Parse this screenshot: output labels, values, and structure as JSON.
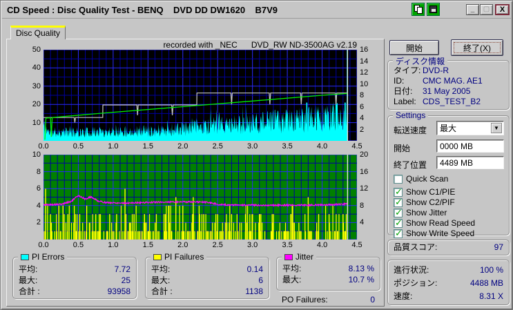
{
  "window": {
    "title": "CD Speed : Disc Quality Test - BENQ    DVD DD DW1620    B7V9",
    "minimize_label": "_",
    "close_label": "X"
  },
  "tab": {
    "label": "Disc Quality"
  },
  "recorded_note": "recorded with _NEC      DVD_RW ND-3500AG v2.19",
  "buttons": {
    "start": "開始",
    "stop": "終了(X)"
  },
  "disc_info": {
    "title": "ディスク情報",
    "rows": [
      {
        "label": "タイプ:",
        "value": "DVD-R"
      },
      {
        "label": "ID:",
        "value": "CMC MAG. AE1"
      },
      {
        "label": "日付:",
        "value": "31 May 2005"
      },
      {
        "label": "Label:",
        "value": "CDS_TEST_B2"
      }
    ]
  },
  "settings": {
    "title": "Settings",
    "speed_label": "転送速度",
    "speed_value": "最大",
    "start_label": "開始",
    "start_value": "0000 MB",
    "end_label": "終了位置",
    "end_value": "4489 MB",
    "checkboxes": [
      {
        "label": "Quick Scan",
        "checked": false
      },
      {
        "label": "Show C1/PIE",
        "checked": true
      },
      {
        "label": "Show C2/PIF",
        "checked": true
      },
      {
        "label": "Show Jitter",
        "checked": true
      },
      {
        "label": "Show Read Speed",
        "checked": true
      },
      {
        "label": "Show Write Speed",
        "checked": true
      }
    ]
  },
  "score": {
    "label": "品質スコア:",
    "value": "97"
  },
  "progress": {
    "rows": [
      {
        "label": "進行状況:",
        "value": "100 %"
      },
      {
        "label": "ポジション:",
        "value": "4488 MB"
      },
      {
        "label": "速度:",
        "value": "8.31 X"
      }
    ]
  },
  "stats": {
    "pi_errors": {
      "title": "PI Errors",
      "swatch": "#00FFFF",
      "rows": [
        {
          "label": "平均:",
          "value": "7.72"
        },
        {
          "label": "最大:",
          "value": "25"
        },
        {
          "label": "合計 :",
          "value": "93958"
        }
      ]
    },
    "pi_failures": {
      "title": "PI Failures",
      "swatch": "#FFFF00",
      "rows": [
        {
          "label": "平均:",
          "value": "0.14"
        },
        {
          "label": "最大:",
          "value": "6"
        },
        {
          "label": "合計 :",
          "value": "1138"
        }
      ]
    },
    "jitter": {
      "title": "Jitter",
      "swatch": "#FF00FF",
      "rows": [
        {
          "label": "平均:",
          "value": "8.13 %"
        },
        {
          "label": "最大:",
          "value": "10.7 %"
        }
      ]
    },
    "po_failures": {
      "label": "PO Failures:",
      "value": "0"
    }
  },
  "chart_data": [
    {
      "type": "area",
      "title": "PI Errors (cyan area, left axis) with read/write speed lines (right axis)",
      "x_range": [
        0,
        4.5
      ],
      "x_end": 4.365,
      "x_ticks": [
        "0.0",
        "0.5",
        "1.0",
        "1.5",
        "2.0",
        "2.5",
        "3.0",
        "3.5",
        "4.0",
        "4.5"
      ],
      "bg": "#000000",
      "grid": {
        "x_minor": 0.1,
        "x_major": 0.5,
        "y_minor": 5,
        "y_major": 10,
        "minor_color": "#0000A0",
        "major_color": "#2A2AFF"
      },
      "y_left": {
        "max": 50,
        "ticks": [
          50,
          40,
          30,
          20,
          10
        ]
      },
      "y_right": {
        "max": 16,
        "ticks": [
          16,
          14,
          12,
          10,
          8,
          6,
          4,
          2
        ]
      },
      "series": [
        {
          "name": "pi-errors",
          "style": "area_noise",
          "axis": "left",
          "color": "#00FFFF",
          "seed": 11,
          "samples": 760,
          "noise_lo": 0.35,
          "noise_hi": 1.5,
          "cap": 24,
          "anchors": [
            [
              0,
              9
            ],
            [
              0.08,
              5
            ],
            [
              0.5,
              5
            ],
            [
              1.0,
              5.5
            ],
            [
              1.5,
              6
            ],
            [
              2.0,
              7
            ],
            [
              2.18,
              8.5
            ],
            [
              2.6,
              9
            ],
            [
              3.0,
              10.5
            ],
            [
              3.5,
              12
            ],
            [
              4.0,
              13.5
            ],
            [
              4.25,
              15
            ],
            [
              4.365,
              15
            ]
          ],
          "spikes": [
            [
              3.78,
              21
            ],
            [
              4.2,
              25
            ],
            [
              4.33,
              21
            ],
            [
              4.362,
              50
            ]
          ]
        },
        {
          "name": "write-speed",
          "style": "line",
          "axis": "right",
          "color": "#C8C8C8",
          "width": 1.2,
          "points": [
            [
              0,
              4.1
            ],
            [
              0.44,
              4.1
            ],
            [
              0.45,
              3.2
            ],
            [
              0.46,
              4.1
            ],
            [
              0.85,
              4.1
            ],
            [
              0.852,
              6.3
            ],
            [
              1.34,
              6.3
            ],
            [
              1.35,
              4.5
            ],
            [
              1.36,
              6.3
            ],
            [
              1.84,
              6.3
            ],
            [
              1.85,
              4.5
            ],
            [
              1.86,
              6.3
            ],
            [
              2.2,
              6.3
            ],
            [
              2.202,
              8.4
            ],
            [
              2.69,
              8.4
            ],
            [
              2.7,
              6.4
            ],
            [
              2.71,
              8.4
            ],
            [
              3.24,
              8.4
            ],
            [
              3.25,
              6.4
            ],
            [
              3.26,
              8.4
            ],
            [
              3.69,
              8.4
            ],
            [
              3.7,
              6.4
            ],
            [
              3.71,
              8.4
            ],
            [
              4.19,
              8.4
            ],
            [
              4.2,
              6.4
            ],
            [
              4.21,
              8.4
            ],
            [
              4.365,
              8.4
            ]
          ]
        },
        {
          "name": "read-speed",
          "style": "line",
          "axis": "right",
          "color": "#00EE00",
          "width": 1.3,
          "points": [
            [
              0.02,
              0.2
            ],
            [
              0.035,
              4.0
            ],
            [
              0.1,
              4.05
            ],
            [
              0.112,
              0.7
            ],
            [
              0.125,
              4.1
            ],
            [
              1.0,
              5.02
            ],
            [
              2.0,
              6.0
            ],
            [
              3.0,
              7.0
            ],
            [
              4.0,
              8.0
            ],
            [
              4.365,
              8.31
            ]
          ]
        },
        {
          "name": "end-marker",
          "style": "vline",
          "x": 4.365,
          "color": "#E0E0E0"
        }
      ]
    },
    {
      "type": "bar",
      "title": "PI Failures (yellow bars, left axis) with jitter % line (right axis)",
      "x_range": [
        0,
        4.5
      ],
      "x_end": 4.365,
      "x_ticks": [
        "0.0",
        "0.5",
        "1.0",
        "1.5",
        "2.0",
        "2.5",
        "3.0",
        "3.5",
        "4.0",
        "4.5"
      ],
      "bg": "#008000",
      "grid": {
        "x_minor": 0.1,
        "x_major": 0.5,
        "y_minor": 1,
        "y_major": 2,
        "minor_color": "#0000A0",
        "major_color": "#2A2AFF"
      },
      "y_left": {
        "max": 10,
        "ticks": [
          10,
          8,
          6,
          4,
          2
        ]
      },
      "y_right": {
        "max": 20,
        "ticks": [
          20,
          16,
          12,
          8,
          4
        ]
      },
      "series": [
        {
          "name": "pi-failures",
          "style": "bars",
          "axis": "left",
          "color": "#FFFF00",
          "seed": 23,
          "step": 0.008,
          "density": 0.4,
          "tall_bars": [
            [
              0.03,
              6
            ],
            [
              0.1,
              3
            ],
            [
              0.22,
              4
            ],
            [
              0.28,
              4
            ],
            [
              0.35,
              3
            ],
            [
              0.52,
              3
            ],
            [
              0.62,
              4
            ],
            [
              0.75,
              3
            ],
            [
              0.8,
              3
            ],
            [
              0.95,
              3
            ],
            [
              1.05,
              3
            ],
            [
              1.17,
              6
            ],
            [
              1.3,
              3
            ],
            [
              1.45,
              3
            ],
            [
              1.62,
              3
            ],
            [
              1.75,
              3
            ],
            [
              1.9,
              5
            ],
            [
              2.0,
              4
            ],
            [
              2.15,
              5
            ],
            [
              2.3,
              3
            ],
            [
              2.5,
              3
            ],
            [
              2.7,
              3
            ],
            [
              2.9,
              3
            ],
            [
              3.1,
              3
            ],
            [
              3.3,
              3
            ],
            [
              3.55,
              3
            ],
            [
              3.8,
              5
            ],
            [
              3.95,
              3
            ],
            [
              4.1,
              3
            ],
            [
              4.3,
              3
            ]
          ]
        },
        {
          "name": "jitter",
          "style": "line_noise",
          "axis": "left",
          "color": "#FF00FF",
          "width": 1.2,
          "seed": 5,
          "noise": 0.09,
          "step": 0.006,
          "anchors": [
            [
              0,
              4.1
            ],
            [
              0.25,
              4.15
            ],
            [
              0.4,
              4.5
            ],
            [
              0.5,
              5.2
            ],
            [
              0.6,
              4.75
            ],
            [
              0.68,
              5.05
            ],
            [
              0.78,
              4.55
            ],
            [
              0.9,
              4.35
            ],
            [
              1.2,
              4.3
            ],
            [
              1.6,
              4.4
            ],
            [
              2.0,
              4.45
            ],
            [
              2.35,
              4.4
            ],
            [
              2.55,
              4.1
            ],
            [
              3.0,
              4.05
            ],
            [
              3.6,
              4.05
            ],
            [
              4.1,
              4.1
            ],
            [
              4.365,
              4.2
            ]
          ]
        },
        {
          "name": "end-marker",
          "style": "vline",
          "x": 4.365,
          "color": "#E0E0E0"
        }
      ]
    }
  ]
}
